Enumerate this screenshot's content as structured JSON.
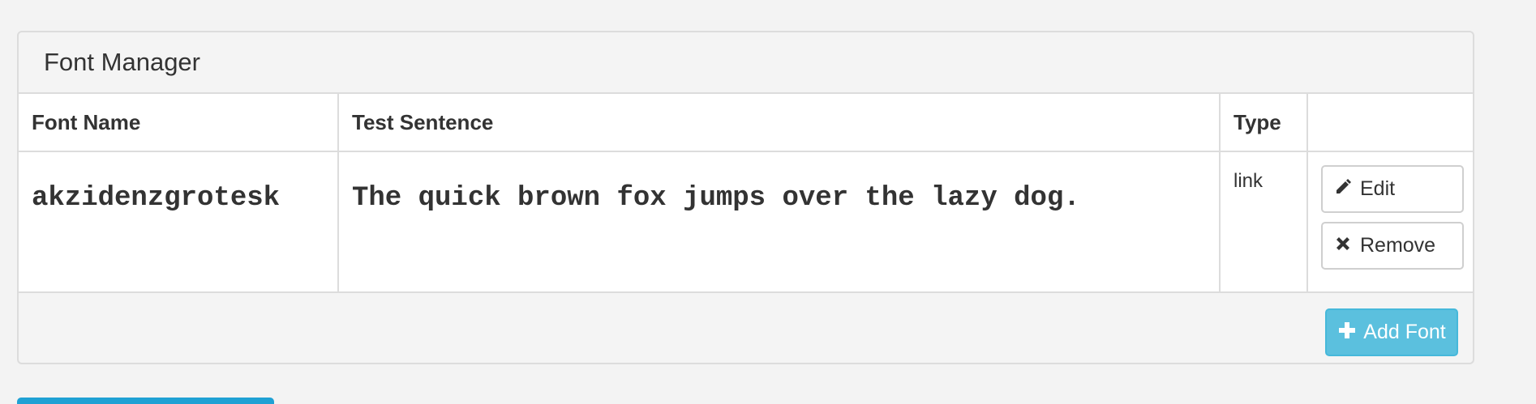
{
  "panel": {
    "title": "Font Manager"
  },
  "table": {
    "headers": [
      "Font Name",
      "Test Sentence",
      "Type",
      ""
    ],
    "rows": [
      {
        "font_name": "akzidenzgrotesk",
        "test_sentence": "The quick brown fox jumps over the lazy dog.",
        "type": "link",
        "edit_label": "Edit",
        "remove_label": "Remove"
      }
    ]
  },
  "footer": {
    "add_label": "Add Font"
  },
  "icons": {
    "edit": "pencil-icon",
    "remove": "close-icon",
    "add": "plus-icon"
  },
  "colors": {
    "add_button": "#5bc0de",
    "bottom_button": "#1fa1d4"
  }
}
